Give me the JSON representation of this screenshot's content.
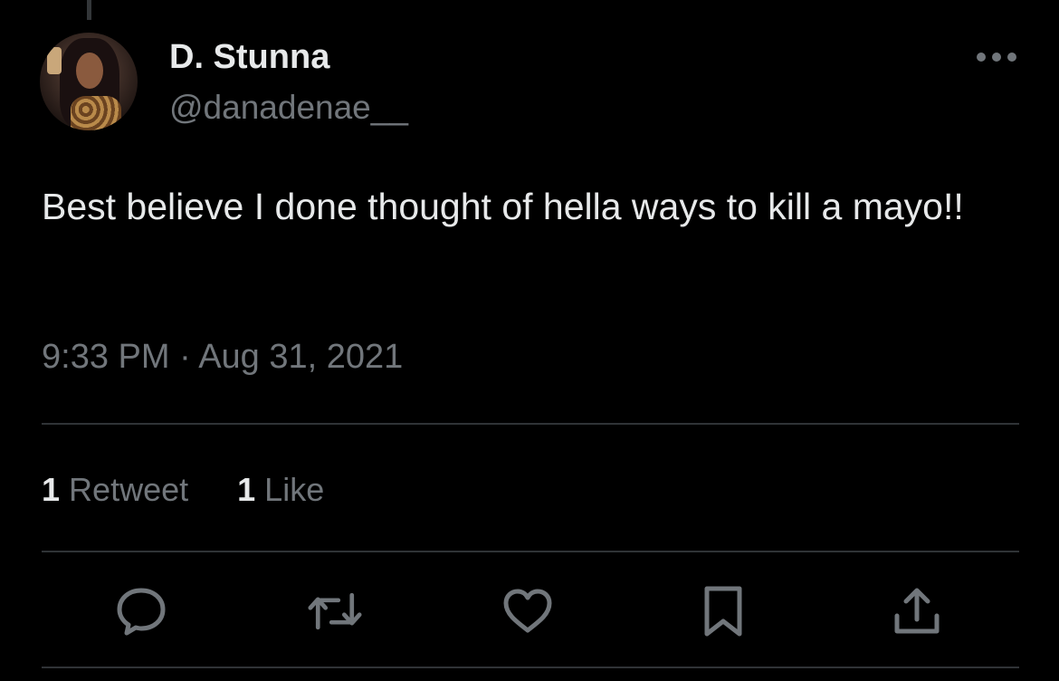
{
  "tweet": {
    "author": {
      "display_name": "D. Stunna",
      "handle": "@danadenae__"
    },
    "text": "Best believe I done thought of hella ways to kill a mayo!!",
    "timestamp": "9:33 PM · Aug 31, 2021",
    "stats": [
      {
        "count": "1",
        "label": "Retweet"
      },
      {
        "count": "1",
        "label": "Like"
      }
    ],
    "actions": [
      "reply-icon",
      "retweet-icon",
      "like-icon",
      "bookmark-icon",
      "share-icon"
    ]
  },
  "colors": {
    "background": "#000000",
    "primary_text": "#e7e9ea",
    "secondary_text": "#71767b",
    "divider": "#2f3336",
    "icon": "#71767b"
  }
}
